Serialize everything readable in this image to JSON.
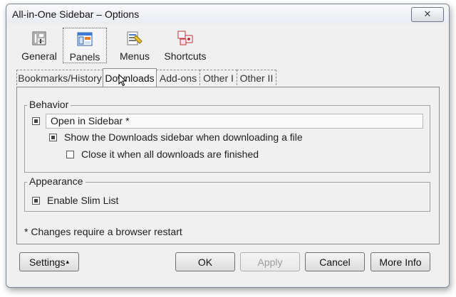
{
  "window": {
    "title": "All-in-One Sidebar – Options"
  },
  "toolbar": [
    {
      "label": "General",
      "icon": "general-icon"
    },
    {
      "label": "Panels",
      "icon": "panels-icon",
      "selected": true
    },
    {
      "label": "Menus",
      "icon": "menus-icon"
    },
    {
      "label": "Shortcuts",
      "icon": "shortcuts-icon"
    }
  ],
  "tabs": [
    {
      "label": "Bookmarks/History"
    },
    {
      "label": "Downloads",
      "active": true
    },
    {
      "label": "Add-ons"
    },
    {
      "label": "Other I"
    },
    {
      "label": "Other II"
    }
  ],
  "behavior": {
    "legend": "Behavior",
    "options": [
      {
        "label": "Open in Sidebar *",
        "checked": true
      },
      {
        "label": "Show the Downloads sidebar when downloading a file",
        "checked": true
      },
      {
        "label": "Close it when all downloads are finished",
        "checked": false
      }
    ]
  },
  "appearance": {
    "legend": "Appearance",
    "options": [
      {
        "label": "Enable Slim List",
        "checked": true
      }
    ]
  },
  "note": "* Changes require a browser restart",
  "buttons": {
    "settings": "Settings",
    "settings_arrow": "▴",
    "ok": "OK",
    "apply": "Apply",
    "cancel": "Cancel",
    "more_info": "More Info"
  }
}
